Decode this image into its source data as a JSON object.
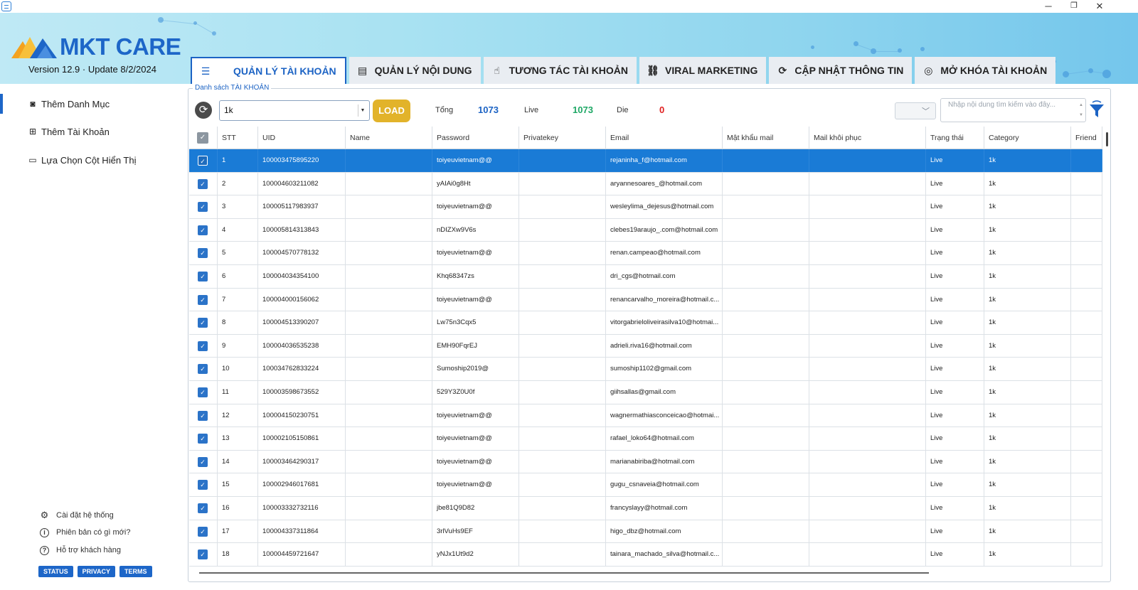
{
  "app": {
    "logo_text": "MKT CARE",
    "version": "Version  12.9 · Update  8/2/2024",
    "brand_color": "#1d66c8"
  },
  "window_controls": {
    "minimize": "─",
    "restore": "❐",
    "close": "✕"
  },
  "tabs": [
    {
      "label": "QUẢN LÝ TÀI KHOẢN",
      "icon": "list-search-icon",
      "glyph": "☰"
    },
    {
      "label": "QUẢN LÝ NỘI DUNG",
      "icon": "document-icon",
      "glyph": "▤"
    },
    {
      "label": "TƯƠNG TÁC TÀI KHOẢN",
      "icon": "hand-pointer-icon",
      "glyph": "☝"
    },
    {
      "label": "VIRAL MARKETING",
      "icon": "network-icon",
      "glyph": "⛓"
    },
    {
      "label": "CẬP NHẬT THÔNG TIN",
      "icon": "refresh-check-icon",
      "glyph": "⟳"
    },
    {
      "label": "MỞ KHÓA TÀI KHOẢN",
      "icon": "fingerprint-icon",
      "glyph": "◎"
    }
  ],
  "sidebar": {
    "items": [
      {
        "label": "Thêm Danh Mục",
        "icon": "folder-add-icon",
        "glyph": "◙"
      },
      {
        "label": "Thêm Tài Khoản",
        "icon": "add-box-icon",
        "glyph": "⊞"
      },
      {
        "label": "Lựa Chọn Cột Hiển Thị",
        "icon": "monitor-icon",
        "glyph": "▭"
      }
    ],
    "bottom": [
      {
        "label": "Cài đặt hệ thống",
        "icon": "gear-icon",
        "glyph": "⚙"
      },
      {
        "label": "Phiên bản có gì mới?",
        "icon": "info-icon",
        "glyph": "i"
      },
      {
        "label": "Hỗ trợ khách hàng",
        "icon": "help-icon",
        "glyph": "?"
      }
    ],
    "pills": [
      "STATUS",
      "PRIVACY",
      "TERMS"
    ]
  },
  "toolbar": {
    "group_label": "Danh sách TÀI KHOẢN",
    "category_value": "1k",
    "load_label": "LOAD",
    "total_label": "Tổng",
    "total_value": "1073",
    "live_label": "Live",
    "live_value": "1073",
    "die_label": "Die",
    "die_value": "0",
    "search_placeholder": "Nhập nội dung tìm kiếm vào đây...",
    "colors": {
      "total": "#1c63c4",
      "live": "#1fa866",
      "die": "#e02020"
    }
  },
  "grid": {
    "columns": [
      "STT",
      "UID",
      "Name",
      "Password",
      "Privatekey",
      "Email",
      "Mật khẩu mail",
      "Mail khôi phục",
      "Trạng thái",
      "Category",
      "Friend"
    ],
    "rows": [
      {
        "stt": "1",
        "uid": "100003475895220",
        "name": "",
        "password": "toiyeuvietnam@@",
        "privatekey": "",
        "email": "rejaninha_f@hotmail.com",
        "mail_pass": "",
        "mail_recovery": "",
        "status": "Live",
        "category": "1k",
        "friend": ""
      },
      {
        "stt": "2",
        "uid": "100004603211082",
        "name": "",
        "password": "yAIAi0g8Ht",
        "privatekey": "",
        "email": "aryannesoares_@hotmail.com",
        "mail_pass": "",
        "mail_recovery": "",
        "status": "Live",
        "category": "1k",
        "friend": ""
      },
      {
        "stt": "3",
        "uid": "100005117983937",
        "name": "",
        "password": "toiyeuvietnam@@",
        "privatekey": "",
        "email": "wesleylima_dejesus@hotmail.com",
        "mail_pass": "",
        "mail_recovery": "",
        "status": "Live",
        "category": "1k",
        "friend": ""
      },
      {
        "stt": "4",
        "uid": "100005814313843",
        "name": "",
        "password": "nDIZXw9V6s",
        "privatekey": "",
        "email": "clebes19araujo_.com@hotmail.com",
        "mail_pass": "",
        "mail_recovery": "",
        "status": "Live",
        "category": "1k",
        "friend": ""
      },
      {
        "stt": "5",
        "uid": "100004570778132",
        "name": "",
        "password": "toiyeuvietnam@@",
        "privatekey": "",
        "email": "renan.campeao@hotmail.com",
        "mail_pass": "",
        "mail_recovery": "",
        "status": "Live",
        "category": "1k",
        "friend": ""
      },
      {
        "stt": "6",
        "uid": "100004034354100",
        "name": "",
        "password": "Khq68347zs",
        "privatekey": "",
        "email": "dri_cgs@hotmail.com",
        "mail_pass": "",
        "mail_recovery": "",
        "status": "Live",
        "category": "1k",
        "friend": ""
      },
      {
        "stt": "7",
        "uid": "100004000156062",
        "name": "",
        "password": "toiyeuvietnam@@",
        "privatekey": "",
        "email": "renancarvalho_moreira@hotmail.c...",
        "mail_pass": "",
        "mail_recovery": "",
        "status": "Live",
        "category": "1k",
        "friend": ""
      },
      {
        "stt": "8",
        "uid": "100004513390207",
        "name": "",
        "password": "Lw75n3Cqx5",
        "privatekey": "",
        "email": "vitorgabrieloliveirasilva10@hotmai...",
        "mail_pass": "",
        "mail_recovery": "",
        "status": "Live",
        "category": "1k",
        "friend": ""
      },
      {
        "stt": "9",
        "uid": "100004036535238",
        "name": "",
        "password": "EMH90FqrEJ",
        "privatekey": "",
        "email": "adrieli.riva16@hotmail.com",
        "mail_pass": "",
        "mail_recovery": "",
        "status": "Live",
        "category": "1k",
        "friend": ""
      },
      {
        "stt": "10",
        "uid": "100034762833224",
        "name": "",
        "password": "Sumoship2019@",
        "privatekey": "",
        "email": "sumoship1102@gmail.com",
        "mail_pass": "",
        "mail_recovery": "",
        "status": "Live",
        "category": "1k",
        "friend": ""
      },
      {
        "stt": "11",
        "uid": "100003598673552",
        "name": "",
        "password": "529Y3Z0U0f",
        "privatekey": "",
        "email": "giihsallas@gmail.com",
        "mail_pass": "",
        "mail_recovery": "",
        "status": "Live",
        "category": "1k",
        "friend": ""
      },
      {
        "stt": "12",
        "uid": "100004150230751",
        "name": "",
        "password": "toiyeuvietnam@@",
        "privatekey": "",
        "email": "wagnermathiasconceicao@hotmai...",
        "mail_pass": "",
        "mail_recovery": "",
        "status": "Live",
        "category": "1k",
        "friend": ""
      },
      {
        "stt": "13",
        "uid": "100002105150861",
        "name": "",
        "password": "toiyeuvietnam@@",
        "privatekey": "",
        "email": "rafael_loko64@hotmail.com",
        "mail_pass": "",
        "mail_recovery": "",
        "status": "Live",
        "category": "1k",
        "friend": ""
      },
      {
        "stt": "14",
        "uid": "100003464290317",
        "name": "",
        "password": "toiyeuvietnam@@",
        "privatekey": "",
        "email": "marianabiriba@hotmail.com",
        "mail_pass": "",
        "mail_recovery": "",
        "status": "Live",
        "category": "1k",
        "friend": ""
      },
      {
        "stt": "15",
        "uid": "100002946017681",
        "name": "",
        "password": "toiyeuvietnam@@",
        "privatekey": "",
        "email": "gugu_csnaveia@hotmail.com",
        "mail_pass": "",
        "mail_recovery": "",
        "status": "Live",
        "category": "1k",
        "friend": ""
      },
      {
        "stt": "16",
        "uid": "100003332732116",
        "name": "",
        "password": "jbe81Q9D82",
        "privatekey": "",
        "email": "francyslayy@hotmail.com",
        "mail_pass": "",
        "mail_recovery": "",
        "status": "Live",
        "category": "1k",
        "friend": ""
      },
      {
        "stt": "17",
        "uid": "100004337311864",
        "name": "",
        "password": "3rlVuHs9EF",
        "privatekey": "",
        "email": "higo_dbz@hotmail.com",
        "mail_pass": "",
        "mail_recovery": "",
        "status": "Live",
        "category": "1k",
        "friend": ""
      },
      {
        "stt": "18",
        "uid": "100004459721647",
        "name": "",
        "password": "yNJx1Ut9d2",
        "privatekey": "",
        "email": "tainara_machado_silva@hotmail.c...",
        "mail_pass": "",
        "mail_recovery": "",
        "status": "Live",
        "category": "1k",
        "friend": ""
      }
    ],
    "selected_row": 0,
    "selection_color": "#1a7bd6"
  }
}
